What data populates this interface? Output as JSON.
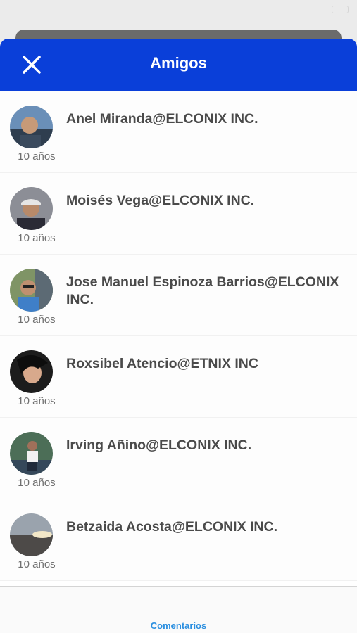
{
  "header": {
    "title": "Amigos",
    "close_icon": "close-icon"
  },
  "friends": [
    {
      "name": "Anel Miranda@ELCONIX INC.",
      "age": "10 años"
    },
    {
      "name": "Moisés Vega@ELCONIX INC.",
      "age": "10 años"
    },
    {
      "name": "Jose Manuel Espinoza Barrios@ELCONIX INC.",
      "age": "10 años"
    },
    {
      "name": "Roxsibel Atencio@ETNIX INC",
      "age": "10 años"
    },
    {
      "name": "Irving Añino@ELCONIX INC.",
      "age": "10 años"
    },
    {
      "name": "Betzaida Acosta@ELCONIX INC.",
      "age": "10 años"
    }
  ],
  "footer": {
    "link_label": "Comentarios"
  },
  "colors": {
    "header_bg": "#0a3fd9",
    "link": "#2b8fe0",
    "name_text": "#4a4a4a"
  }
}
